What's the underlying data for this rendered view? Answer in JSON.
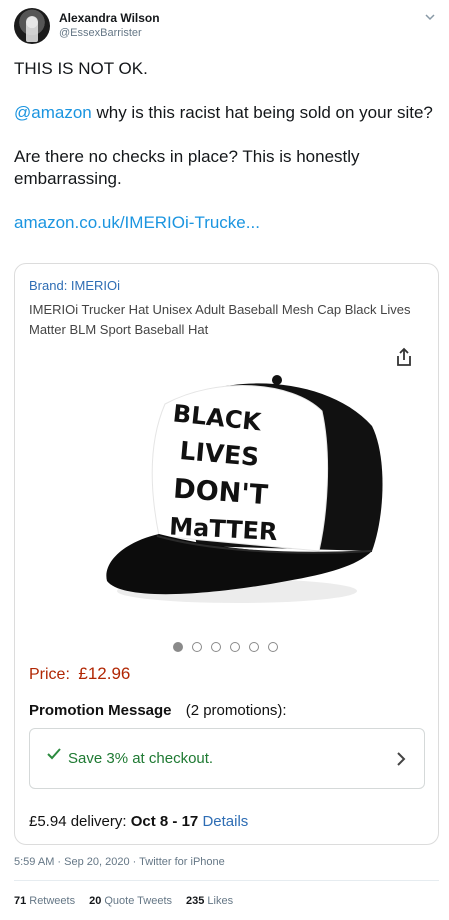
{
  "author": {
    "display_name": "Alexandra Wilson",
    "handle": "@EssexBarrister"
  },
  "tweet": {
    "line1": "THIS IS NOT OK.",
    "mention": "@amazon",
    "line2_rest": " why is this racist hat being sold on your site?",
    "line3": "Are there no checks in place? This is honestly embarrassing.",
    "link": "amazon.co.uk/IMERIOi-Trucke..."
  },
  "card": {
    "brand": "Brand: IMERIOi",
    "title": "IMERIOi Trucker Hat Unisex Adult Baseball Mesh Cap Black Lives Matter BLM Sport Baseball Hat",
    "hat_text": [
      "BLACK",
      "LIVES",
      "DON'T",
      "MaTTER"
    ],
    "carousel": {
      "total": 6,
      "active": 0
    },
    "price_label": "Price:",
    "price_value": "£12.96",
    "promo_title": "Promotion Message",
    "promo_count": "(2 promotions):",
    "promo_text": "Save 3% at checkout.",
    "delivery_prefix": "£5.94 delivery: ",
    "delivery_dates": "Oct 8 - 17",
    "delivery_details": "Details"
  },
  "meta": {
    "timestamp": "5:59 AM · Sep 20, 2020 · Twitter for iPhone"
  },
  "stats": {
    "retweets_count": "71",
    "retweets_label": "Retweets",
    "quotes_count": "20",
    "quotes_label": "Quote Tweets",
    "likes_count": "235",
    "likes_label": "Likes"
  },
  "colors": {
    "link": "#1b95e0",
    "brand_link": "#2e6db4",
    "price": "#b12704",
    "promo_green": "#1f7a33"
  },
  "icons": [
    "chevron-down-icon",
    "share-icon",
    "checkmark-icon",
    "chevron-right-icon"
  ]
}
